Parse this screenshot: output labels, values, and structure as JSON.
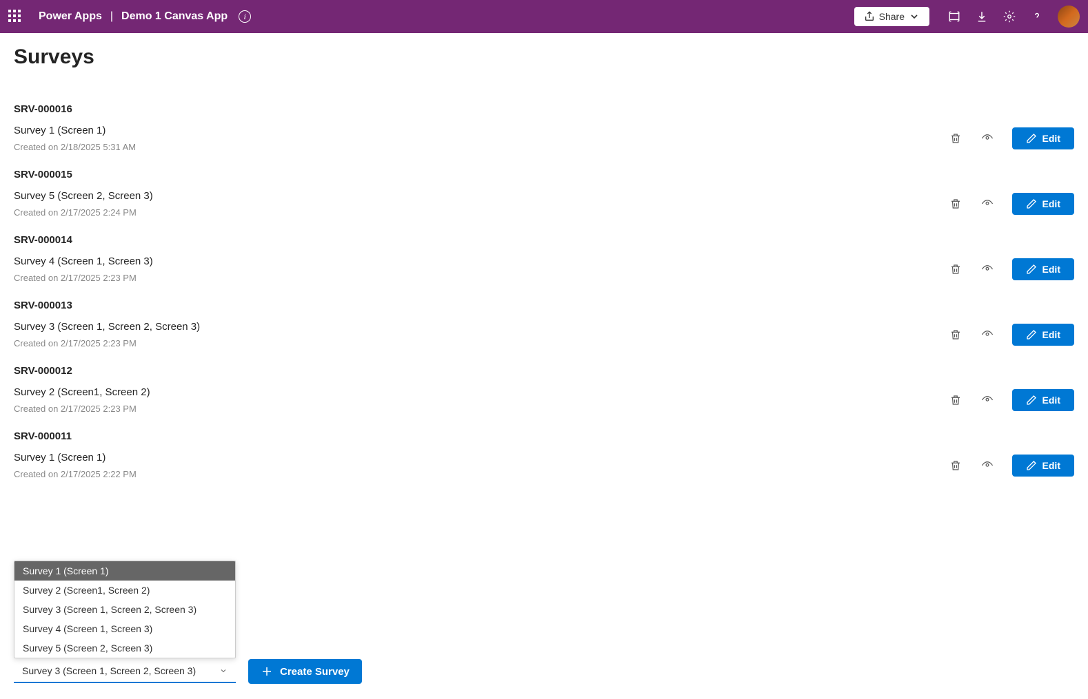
{
  "header": {
    "app_name": "Power Apps",
    "divider": "|",
    "app_title": "Demo 1 Canvas App",
    "share_label": "Share"
  },
  "page": {
    "title": "Surveys"
  },
  "surveys": [
    {
      "id": "SRV-000016",
      "name": "Survey 1 (Screen 1)",
      "created": "Created on 2/18/2025 5:31 AM",
      "edit_label": "Edit"
    },
    {
      "id": "SRV-000015",
      "name": "Survey 5 (Screen 2, Screen 3)",
      "created": "Created on 2/17/2025 2:24 PM",
      "edit_label": "Edit"
    },
    {
      "id": "SRV-000014",
      "name": "Survey 4 (Screen 1, Screen 3)",
      "created": "Created on 2/17/2025 2:23 PM",
      "edit_label": "Edit"
    },
    {
      "id": "SRV-000013",
      "name": "Survey 3 (Screen 1, Screen 2, Screen 3)",
      "created": "Created on 2/17/2025 2:23 PM",
      "edit_label": "Edit"
    },
    {
      "id": "SRV-000012",
      "name": "Survey 2 (Screen1, Screen 2)",
      "created": "Created on 2/17/2025 2:23 PM",
      "edit_label": "Edit"
    },
    {
      "id": "SRV-000011",
      "name": "Survey 1 (Screen 1)",
      "created": "Created on 2/17/2025 2:22 PM",
      "edit_label": "Edit"
    }
  ],
  "dropdown": {
    "selected": "Survey 3 (Screen 1, Screen 2, Screen 3)",
    "options": [
      "Survey 1 (Screen 1)",
      "Survey 2 (Screen1, Screen 2)",
      "Survey 3 (Screen 1, Screen 2, Screen 3)",
      "Survey 4 (Screen 1, Screen 3)",
      "Survey 5 (Screen 2, Screen 3)"
    ],
    "highlighted_index": 0
  },
  "create": {
    "label": "Create Survey"
  }
}
